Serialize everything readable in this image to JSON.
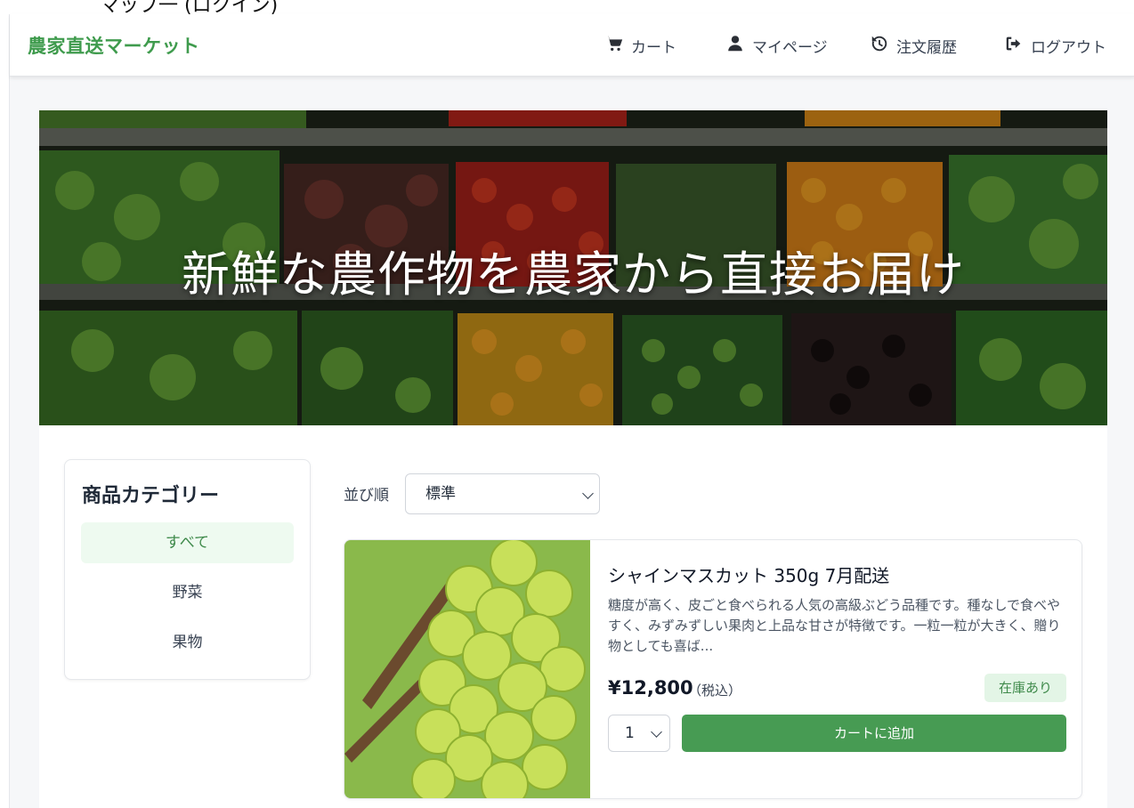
{
  "caption": "マップ一 (ロクイン)",
  "header": {
    "brand": "農家直送マーケット",
    "nav": {
      "cart": "カート",
      "mypage": "マイページ",
      "orders": "注文履歴",
      "logout": "ログアウト"
    }
  },
  "hero": {
    "title": "新鮮な農作物を農家から直接お届け"
  },
  "sidebar": {
    "title": "商品カテゴリー",
    "items": [
      {
        "label": "すべて",
        "active": true
      },
      {
        "label": "野菜",
        "active": false
      },
      {
        "label": "果物",
        "active": false
      }
    ]
  },
  "sort": {
    "label": "並び順",
    "selected": "標準"
  },
  "products": [
    {
      "name": "シャインマスカット 350g 7月配送",
      "description": "糖度が高く、皮ごと食べられる人気の高級ぶどう品種です。種なしで食べやすく、みずみずしい果肉と上品な甘さが特徴です。一粒一粒が大きく、贈り物としても喜ば...",
      "price": "¥12,800",
      "tax_note": "（税込）",
      "stock": "在庫あり",
      "quantity": "1",
      "add_button": "カートに追加"
    }
  ],
  "colors": {
    "brand": "#3f9b4d",
    "button": "#479b53",
    "active_bg": "#eefaf0"
  },
  "icons": {
    "cart": "cart-icon",
    "mypage": "user-icon",
    "orders": "history-icon",
    "logout": "logout-icon"
  }
}
